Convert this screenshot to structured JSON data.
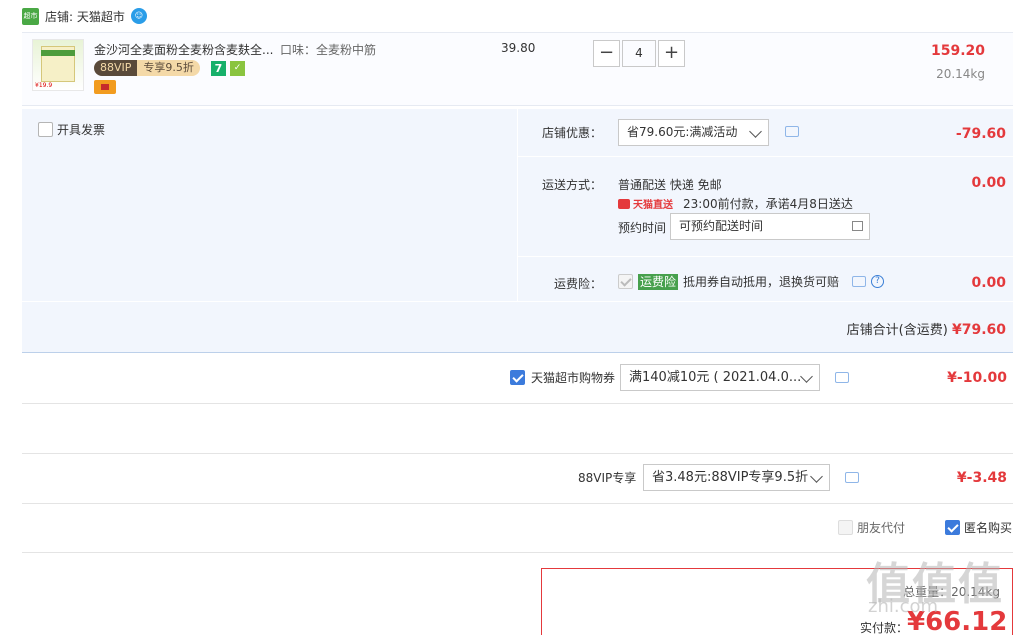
{
  "shop": {
    "tmall_logo": "超市",
    "label": "店铺: 天猫超市"
  },
  "product": {
    "image_price": "¥19.9",
    "title": "金沙河全麦面粉全麦粉含麦麸全...",
    "sku": "口味：全麦粉中筋",
    "vip_a": "88VIP",
    "vip_b": "专享9.5折",
    "tag_seven": "7",
    "unit_price": "39.80",
    "quantity": "4",
    "minus": "−",
    "plus": "+",
    "line_total": "159.20",
    "weight": "20.14kg"
  },
  "options": {
    "invoice_label": "开具发票",
    "shop_discount_label": "店铺优惠：",
    "shop_discount_value": "省79.60元:满减活动",
    "shop_discount_amount": "-79.60",
    "shipping_label": "运送方式：",
    "shipping_method": "普通配送 快递 免邮",
    "tmall_direct": "天猫直送",
    "shipping_promise": "23:00前付款，承诺4月8日送达",
    "reserve_label": "预约时间",
    "reserve_placeholder": "可预约配送时间",
    "shipping_amount": "0.00",
    "insurance_label": "运费险：",
    "insurance_tag": "运费险",
    "insurance_desc": "抵用券自动抵用，退换货可赔",
    "insurance_amount": "0.00",
    "subtotal_label": "店铺合计(含运费)",
    "subtotal_amount": "¥79.60"
  },
  "coupon": {
    "label": "天猫超市购物券",
    "value": "满140减10元 ( 2021.04.0...",
    "amount": "¥-10.00"
  },
  "vip_row": {
    "label": "88VIP专享",
    "value": "省3.48元:88VIP专享9.5折",
    "amount": "¥-3.48"
  },
  "flags": {
    "friend_pay": "朋友代付",
    "anonymous": "匿名购买"
  },
  "pay": {
    "weight": "总重量：20.14kg",
    "label": "实付款：",
    "amount": "¥66.12"
  },
  "watermark": {
    "big": "值值值",
    "small": "zhi.com"
  },
  "colors": {
    "accent_red": "#e4393c",
    "panel_bg": "#f2f6fd",
    "check_blue": "#3c7bdc"
  },
  "icons": [
    "tmall-logo-icon",
    "wangwang-icon",
    "message-icon",
    "calendar-icon",
    "help-icon",
    "chevron-down-icon"
  ]
}
